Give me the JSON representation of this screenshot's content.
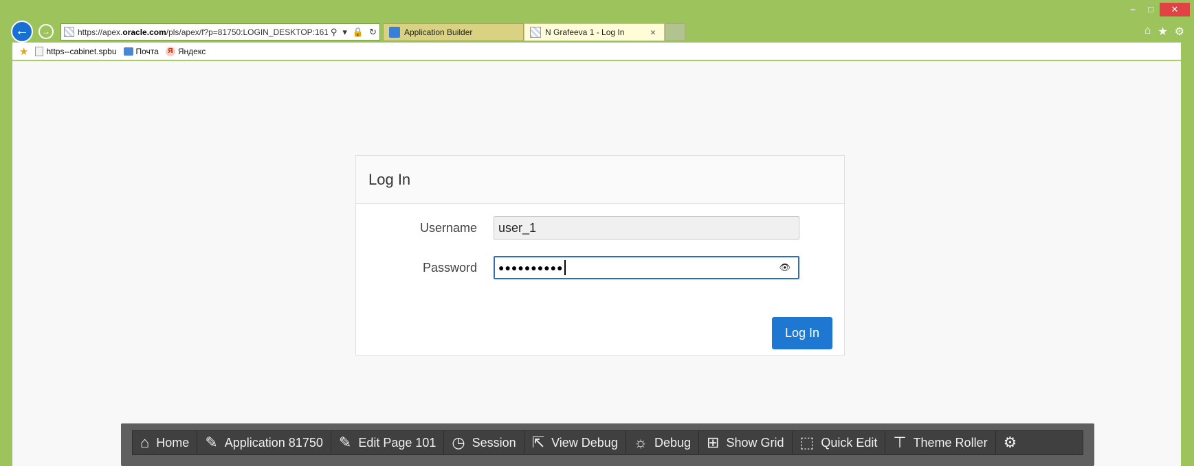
{
  "browser": {
    "url_prefix": "https://apex.",
    "url_domain": "oracle.com",
    "url_rest": "/pls/apex/f?p=81750:LOGIN_DESKTOP:161(",
    "tabs": [
      {
        "label": "Application Builder"
      },
      {
        "label": "N Grafeeva 1 - Log In"
      }
    ],
    "tab_close": "×",
    "favorites": [
      {
        "label": "https--cabinet.spbu"
      },
      {
        "label": "Почта"
      },
      {
        "label": "Яндекс"
      }
    ]
  },
  "login": {
    "title": "Log In",
    "username_label": "Username",
    "username_value": "user_1",
    "password_label": "Password",
    "password_value": "●●●●●●●●●●",
    "button_label": "Log In"
  },
  "devbar": {
    "items": [
      {
        "label": "Home",
        "icon": "home-icon"
      },
      {
        "label": "Application 81750",
        "icon": "edit-app-icon"
      },
      {
        "label": "Edit Page 101",
        "icon": "edit-page-icon"
      },
      {
        "label": "Session",
        "icon": "clock-icon"
      },
      {
        "label": "View Debug",
        "icon": "view-debug-icon"
      },
      {
        "label": "Debug",
        "icon": "bug-icon"
      },
      {
        "label": "Show Grid",
        "icon": "grid-icon"
      },
      {
        "label": "Quick Edit",
        "icon": "quick-edit-icon"
      },
      {
        "label": "Theme Roller",
        "icon": "paint-roller-icon"
      }
    ]
  },
  "colors": {
    "window": "#9dc35c",
    "primary_button": "#1e78d2",
    "devbar": "#404040"
  }
}
